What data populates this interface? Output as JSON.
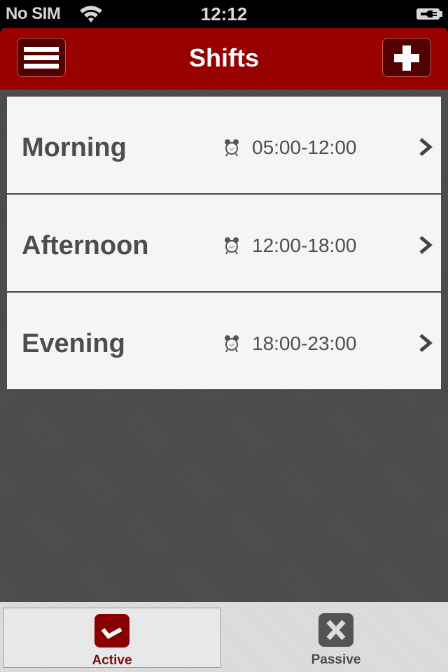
{
  "status_bar": {
    "carrier": "No SIM",
    "time": "12:12",
    "wifi_icon": "wifi-icon",
    "battery_icon": "battery-charging-icon"
  },
  "nav": {
    "title": "Shifts",
    "left_button_icon": "menu-icon",
    "right_button_icon": "plus-icon",
    "color": "#990000"
  },
  "shifts": [
    {
      "name": "Morning",
      "time": "05:00-12:00",
      "icon": "alarm-clock-icon"
    },
    {
      "name": "Afternoon",
      "time": "12:00-18:00",
      "icon": "alarm-clock-icon"
    },
    {
      "name": "Evening",
      "time": "18:00-23:00",
      "icon": "alarm-clock-icon"
    }
  ],
  "tabs": [
    {
      "label": "Active",
      "icon": "checkmark-icon",
      "selected": true,
      "color": "#880000"
    },
    {
      "label": "Passive",
      "icon": "x-icon",
      "selected": false,
      "color": "#545454"
    }
  ]
}
